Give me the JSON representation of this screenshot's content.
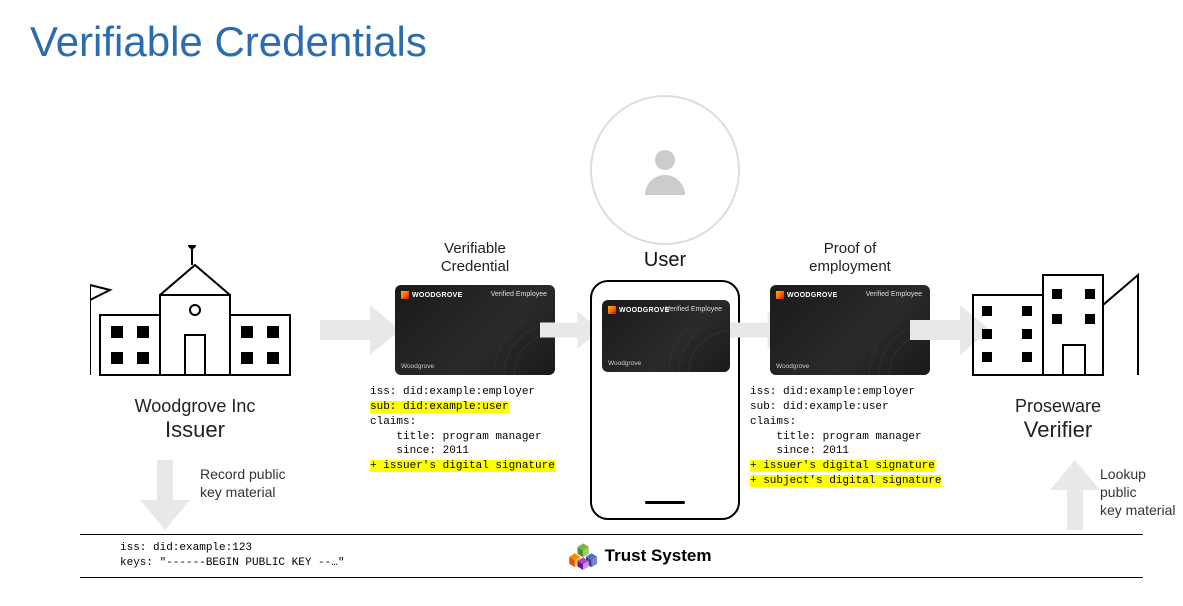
{
  "title": "Verifiable Credentials",
  "issuer": {
    "name": "Woodgrove Inc",
    "role": "Issuer"
  },
  "verifier": {
    "name": "Proseware",
    "role": "Verifier"
  },
  "user": {
    "label": "User"
  },
  "flow": {
    "cred_label": "Verifiable\nCredential",
    "proof_label": "Proof of\nemployment",
    "record_label": "Record public\nkey material",
    "lookup_label": "Lookup public\nkey material"
  },
  "card": {
    "logo_text": "WOODGROVE",
    "badge_text": "Verified Employee",
    "brand_text": "Woodgrove"
  },
  "code_left": {
    "l1": "iss: did:example:employer",
    "l2": "sub: did:example:user",
    "l3": "claims:",
    "l4": "    title: program manager",
    "l5": "    since: 2011",
    "l6": "+ issuer's digital signature"
  },
  "code_right": {
    "l1": "iss: did:example:employer",
    "l2": "sub: did:example:user",
    "l3": "claims:",
    "l4": "    title: program manager",
    "l5": "    since: 2011",
    "l6": "+ issuer's digital signature",
    "l7": "+ subject's digital signature"
  },
  "trust": {
    "label": "Trust System",
    "code_l1": "iss: did:example:123",
    "code_l2": "keys: \"------BEGIN PUBLIC KEY --…\""
  }
}
